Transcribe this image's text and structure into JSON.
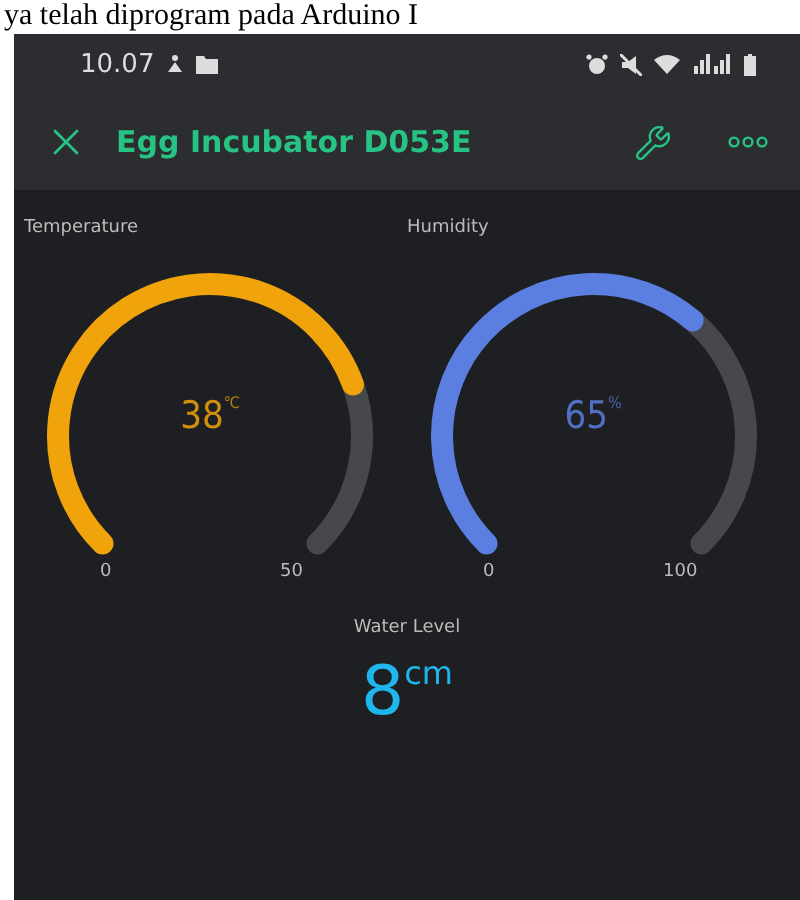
{
  "caption": "ya telah diprogram pada Arduino I",
  "status_bar": {
    "time": "10.07"
  },
  "app_bar": {
    "title": "Egg Incubator D053E"
  },
  "gauges": [
    {
      "label": "Temperature",
      "value": "38",
      "unit": "℃",
      "min": "0",
      "max": "50",
      "color": "#f0a30a"
    },
    {
      "label": "Humidity",
      "value": "65",
      "unit": "%",
      "min": "0",
      "max": "100",
      "color": "#5b7fe0"
    }
  ],
  "value_display": {
    "label": "Water Level",
    "value": "8",
    "unit": "cm"
  }
}
